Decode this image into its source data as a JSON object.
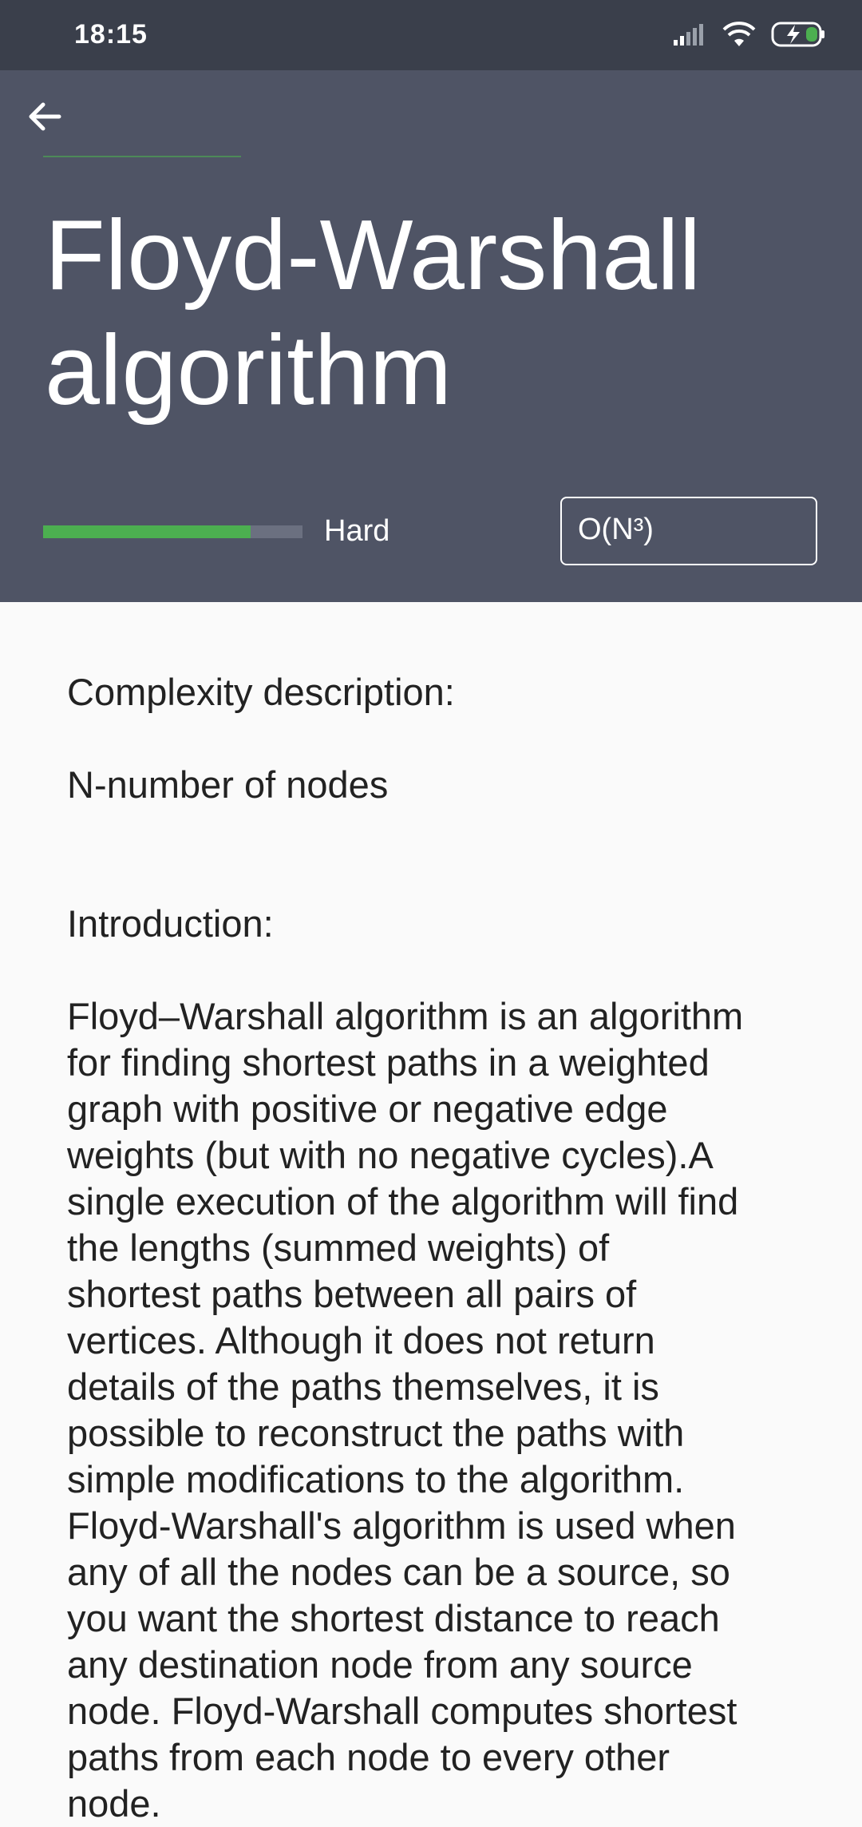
{
  "status_bar": {
    "time": "18:15",
    "icons": [
      "signal-icon",
      "wifi-icon",
      "battery-charging-icon"
    ]
  },
  "header": {
    "back_icon": "arrow-left-icon",
    "title_line1": "Floyd-Warshall",
    "title_line2": "algorithm",
    "difficulty_label": "Hard",
    "difficulty_level": 0.8,
    "complexity": "O(N³)"
  },
  "content": {
    "complexity_heading": "Complexity description:",
    "complexity_text": "N-number of nodes",
    "intro_heading": "Introduction:",
    "intro_lines": [
      "Floyd–Warshall algorithm is an algorithm",
      "for finding shortest paths in a weighted",
      "graph with positive or negative edge",
      "weights (but with no negative cycles).A",
      "single execution of the algorithm will find",
      "the lengths (summed weights) of",
      "shortest paths between all pairs of",
      "vertices. Although it does not return",
      "details of the paths themselves, it is",
      "possible to reconstruct the paths with",
      "simple modifications to the algorithm.",
      "Floyd-Warshall's algorithm is used when",
      "any of all the nodes can be a source, so",
      "you want the shortest distance to reach",
      "any destination node from any source",
      "node. Floyd-Warshall computes shortest",
      "paths from each node to every other",
      "node."
    ]
  },
  "colors": {
    "status_bar_bg": "#3a3f4b",
    "header_bg": "#4f5465",
    "accent_green": "#4caf50",
    "content_bg": "#fafafa"
  }
}
